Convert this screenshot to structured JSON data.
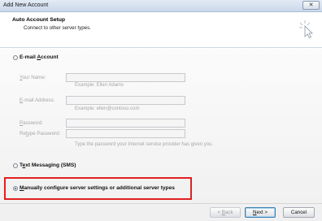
{
  "window": {
    "title": "Add New Account",
    "close_label": "✕"
  },
  "header": {
    "title": "Auto Account Setup",
    "subtitle": "Connect to other server types."
  },
  "options": {
    "email_account": {
      "prefix": "E-mail ",
      "accel": "A",
      "suffix": "ccount",
      "selected": false
    },
    "text_messaging": {
      "prefix": "T",
      "accel": "e",
      "suffix": "xt Messaging (SMS)",
      "selected": false
    },
    "manual": {
      "accel": "M",
      "suffix": "anually configure server settings or additional server types",
      "selected": true
    }
  },
  "fields": {
    "your_name": {
      "accel": "Y",
      "rest": "our Name:",
      "value": "",
      "example": "Example: Ellen Adams"
    },
    "email_address": {
      "accel": "E",
      "rest": "-mail Address:",
      "value": "",
      "example": "Example: ellen@contoso.com"
    },
    "password": {
      "accel": "P",
      "rest": "assword:",
      "value": ""
    },
    "retype_password": {
      "pre": "Re",
      "accel": "t",
      "rest": "ype Password:",
      "value": "",
      "hint": "Type the password your Internet service provider has given you."
    }
  },
  "buttons": {
    "back": {
      "prefix": "< ",
      "accel": "B",
      "suffix": "ack",
      "enabled": false
    },
    "next": {
      "accel": "N",
      "suffix": "ext >",
      "enabled": true
    },
    "cancel": {
      "label": "Cancel",
      "enabled": true
    }
  },
  "colors": {
    "highlight_border": "#e02020",
    "selected_dot": "#2c4e8c"
  }
}
